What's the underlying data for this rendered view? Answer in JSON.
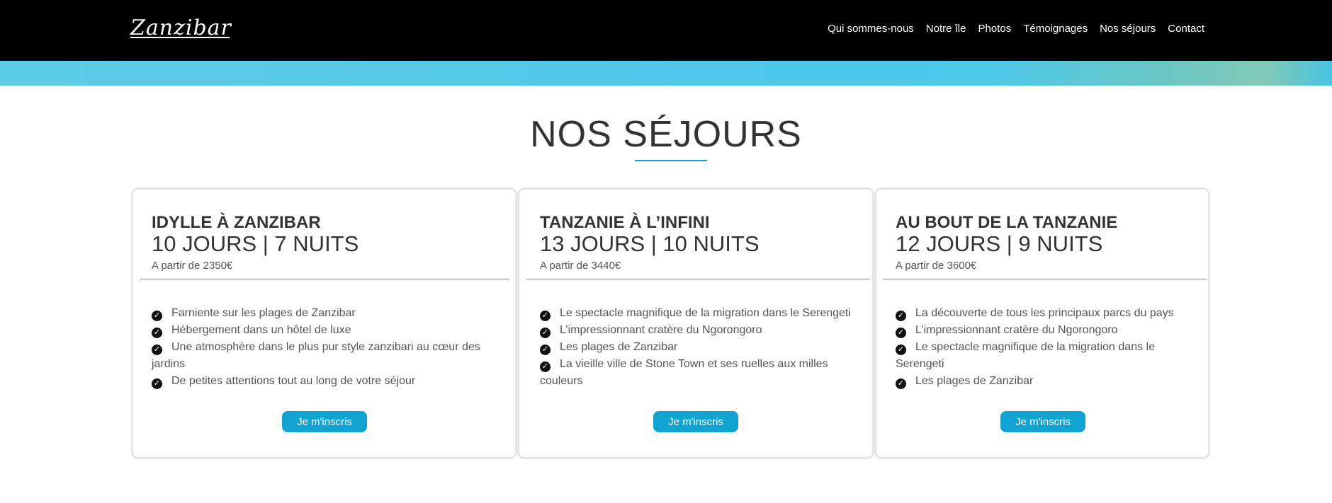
{
  "header": {
    "logo_text": "Zanzibar",
    "nav": [
      "Qui sommes-nous",
      "Notre île",
      "Photos",
      "Témoignages",
      "Nos séjours",
      "Contact"
    ]
  },
  "section": {
    "title": "NOS SÉJOURS",
    "accent_color": "#1aa3cf"
  },
  "cards": [
    {
      "name": "IDYLLE À ZANZIBAR",
      "duration": "10 JOURS | 7 NUITS",
      "price": "A partir de 2350€",
      "features": [
        "Farniente sur les plages de Zanzibar",
        "Hébergement dans un hôtel de luxe",
        "Une atmosphère dans le plus pur style zanzibari au cœur des jardins",
        "De petites attentions tout au long de votre séjour"
      ],
      "button": "Je m'inscris"
    },
    {
      "name": "TANZANIE À L’INFINI",
      "duration": "13 JOURS | 10 NUITS",
      "price": "A partir de 3440€",
      "features": [
        "Le spectacle magnifique de la migration dans le Serengeti",
        "L’impressionnant cratère du Ngorongoro",
        "Les plages de Zanzibar",
        "La vieille ville de Stone Town et ses ruelles aux milles couleurs"
      ],
      "button": "Je m'inscris"
    },
    {
      "name": "AU BOUT DE LA TANZANIE",
      "duration": "12 JOURS | 9 NUITS",
      "price": "A partir de 3600€",
      "features": [
        "La découverte de tous les principaux parcs du pays",
        "L’impressionnant cratère du Ngorongoro",
        "Le spectacle magnifique de la migration dans le Serengeti",
        "Les plages de Zanzibar"
      ],
      "button": "Je m'inscris"
    }
  ],
  "colors": {
    "topbar": "#000000",
    "button": "#11a3d1",
    "card_border": "#e6e6e6"
  }
}
